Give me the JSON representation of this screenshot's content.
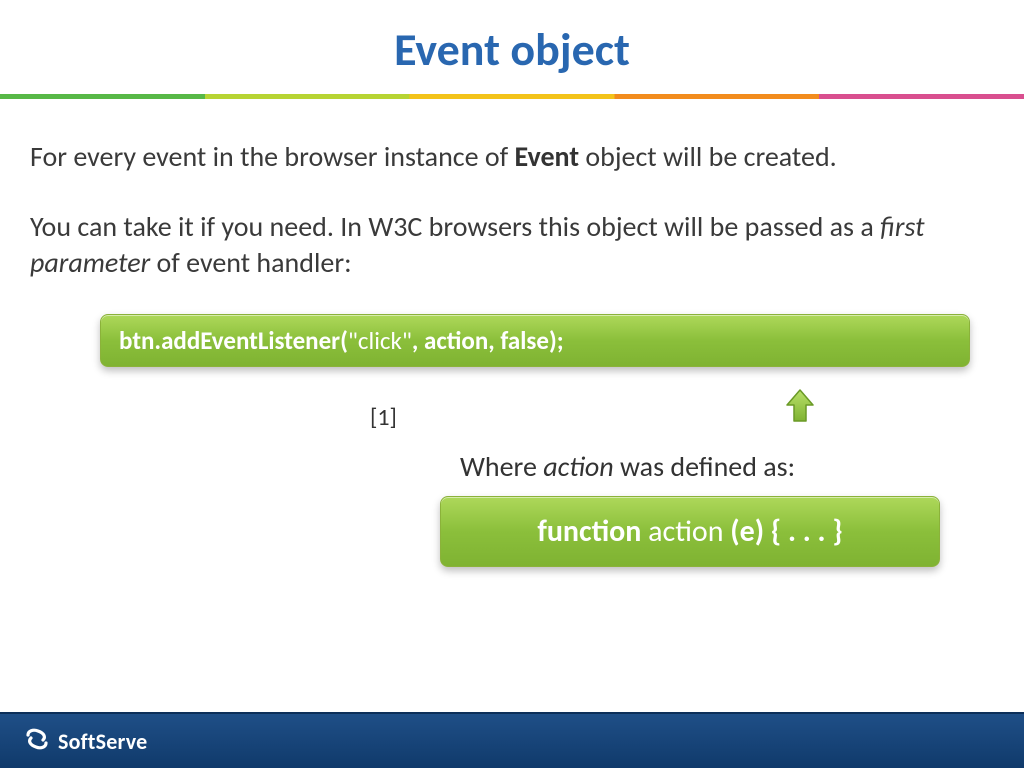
{
  "title": "Event object",
  "para1": {
    "pre": "For every event in the browser instance of ",
    "bold": "Event",
    "post": " object will be created."
  },
  "para2": {
    "pre": "You can take it if you need. In W3C browsers this object will be passed as a ",
    "italic": "first parameter",
    "post": " of event handler:"
  },
  "code1": {
    "s1": "btn.addEventListener(",
    "s2": "\"click\"",
    "s3": ", action, ",
    "s4": "false);"
  },
  "annot_ref": "[1]",
  "where": {
    "pre": "Where ",
    "italic": "action",
    "post": " was defined as:"
  },
  "code2": {
    "s1": "function",
    "s2": " action ",
    "s3": "(e) { . . . }"
  },
  "footer_brand": "SoftServe"
}
